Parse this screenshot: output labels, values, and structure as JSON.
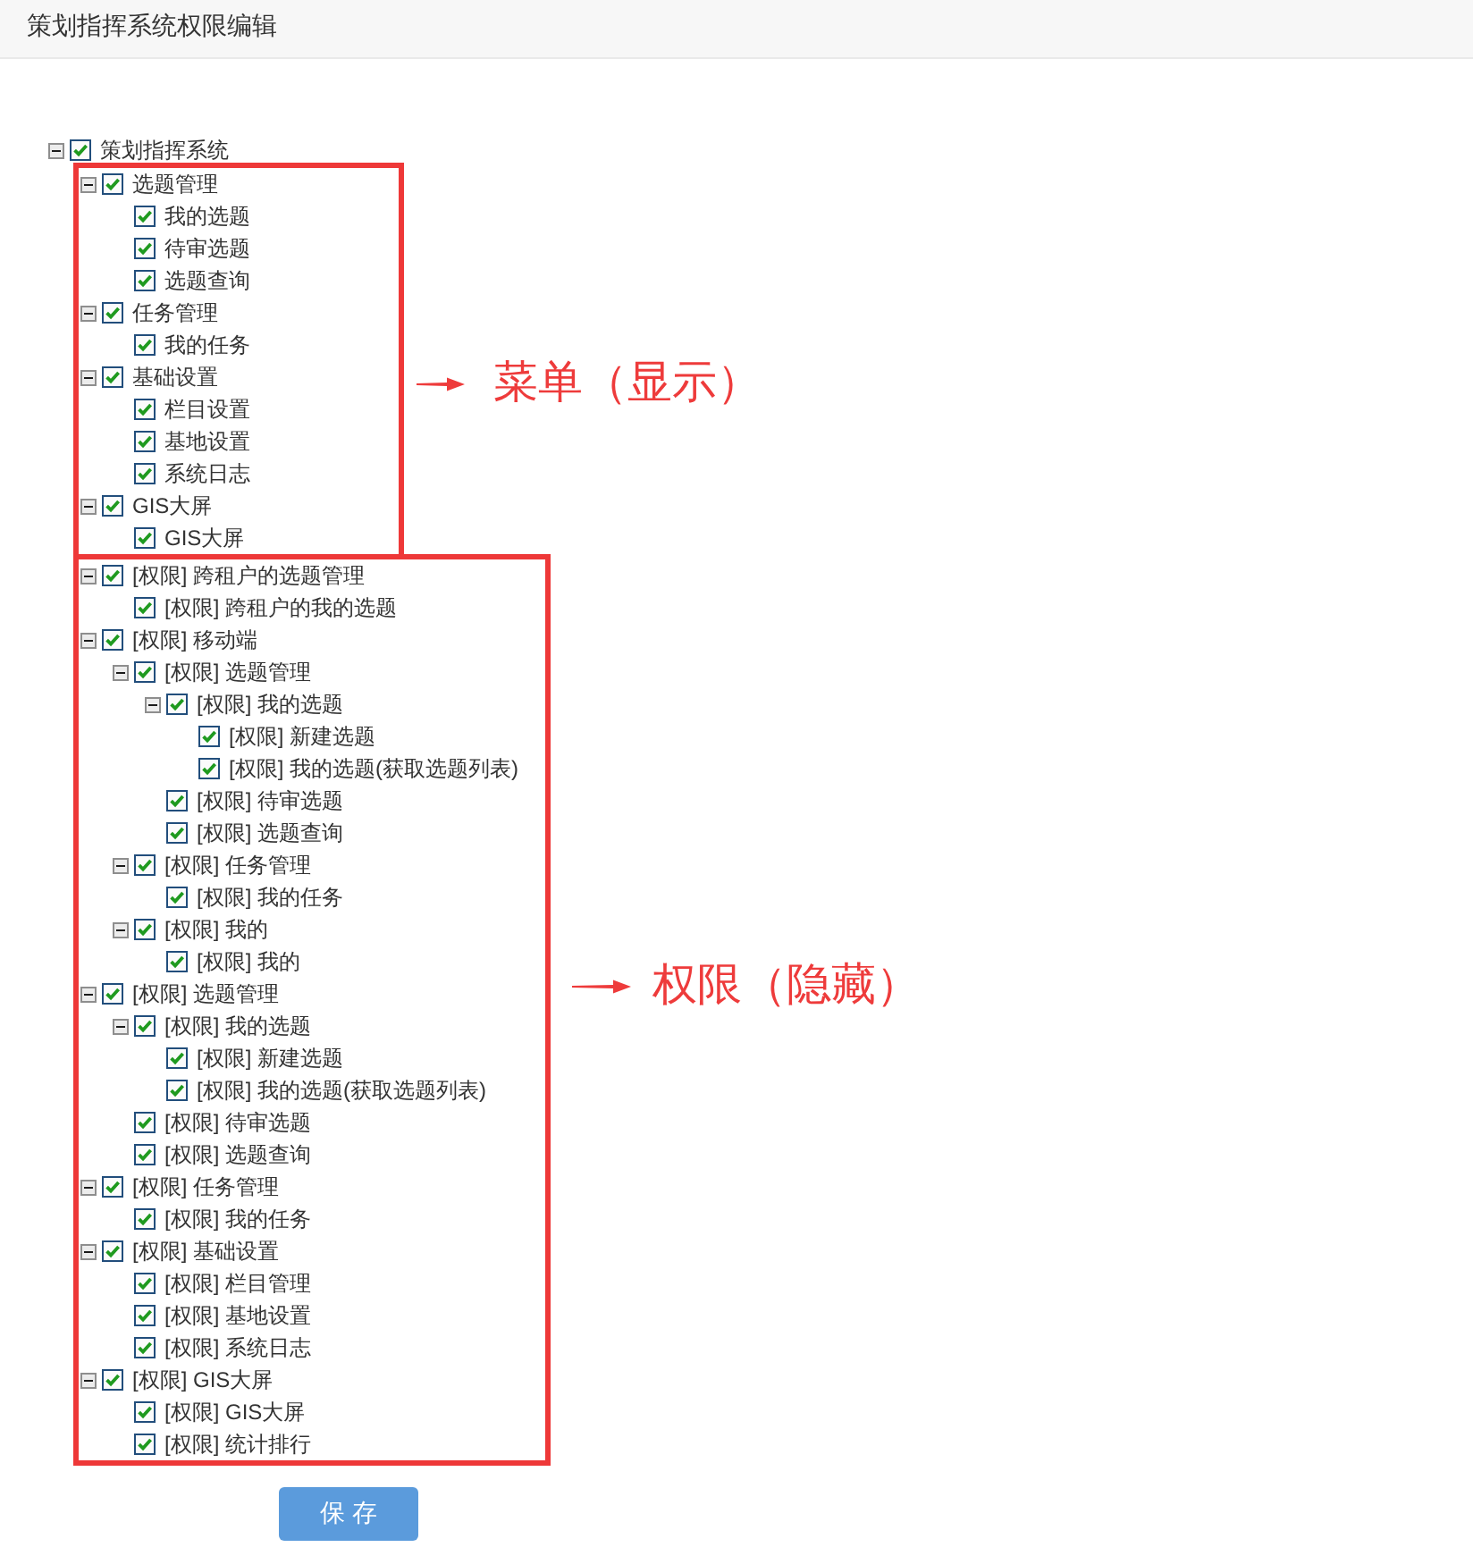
{
  "header": {
    "title": "策划指挥系统权限编辑"
  },
  "tree": {
    "label": "策划指挥系统",
    "checked": true,
    "expanded": true,
    "sections": [
      {
        "annotation": "菜单（显示）",
        "children": [
          {
            "label": "选题管理",
            "checked": true,
            "expanded": true,
            "children": [
              {
                "label": "我的选题",
                "checked": true
              },
              {
                "label": "待审选题",
                "checked": true
              },
              {
                "label": "选题查询",
                "checked": true
              }
            ]
          },
          {
            "label": "任务管理",
            "checked": true,
            "expanded": true,
            "children": [
              {
                "label": "我的任务",
                "checked": true
              }
            ]
          },
          {
            "label": "基础设置",
            "checked": true,
            "expanded": true,
            "children": [
              {
                "label": "栏目设置",
                "checked": true
              },
              {
                "label": "基地设置",
                "checked": true
              },
              {
                "label": "系统日志",
                "checked": true
              }
            ]
          },
          {
            "label": "GIS大屏",
            "checked": true,
            "expanded": true,
            "children": [
              {
                "label": "GIS大屏",
                "checked": true
              }
            ]
          }
        ]
      },
      {
        "annotation": "权限（隐藏）",
        "children": [
          {
            "label": "[权限] 跨租户的选题管理",
            "checked": true,
            "expanded": true,
            "children": [
              {
                "label": "[权限] 跨租户的我的选题",
                "checked": true
              }
            ]
          },
          {
            "label": "[权限] 移动端",
            "checked": true,
            "expanded": true,
            "children": [
              {
                "label": "[权限] 选题管理",
                "checked": true,
                "expanded": true,
                "children": [
                  {
                    "label": "[权限] 我的选题",
                    "checked": true,
                    "expanded": true,
                    "children": [
                      {
                        "label": "[权限] 新建选题",
                        "checked": true
                      },
                      {
                        "label": "[权限] 我的选题(获取选题列表)",
                        "checked": true
                      }
                    ]
                  },
                  {
                    "label": "[权限] 待审选题",
                    "checked": true
                  },
                  {
                    "label": "[权限] 选题查询",
                    "checked": true
                  }
                ]
              },
              {
                "label": "[权限] 任务管理",
                "checked": true,
                "expanded": true,
                "children": [
                  {
                    "label": "[权限] 我的任务",
                    "checked": true
                  }
                ]
              },
              {
                "label": "[权限] 我的",
                "checked": true,
                "expanded": true,
                "children": [
                  {
                    "label": "[权限] 我的",
                    "checked": true
                  }
                ]
              }
            ]
          },
          {
            "label": "[权限] 选题管理",
            "checked": true,
            "expanded": true,
            "children": [
              {
                "label": "[权限] 我的选题",
                "checked": true,
                "expanded": true,
                "children": [
                  {
                    "label": "[权限] 新建选题",
                    "checked": true
                  },
                  {
                    "label": "[权限] 我的选题(获取选题列表)",
                    "checked": true
                  }
                ]
              },
              {
                "label": "[权限] 待审选题",
                "checked": true
              },
              {
                "label": "[权限] 选题查询",
                "checked": true
              }
            ]
          },
          {
            "label": "[权限] 任务管理",
            "checked": true,
            "expanded": true,
            "children": [
              {
                "label": "[权限] 我的任务",
                "checked": true
              }
            ]
          },
          {
            "label": "[权限] 基础设置",
            "checked": true,
            "expanded": true,
            "children": [
              {
                "label": "[权限] 栏目管理",
                "checked": true
              },
              {
                "label": "[权限] 基地设置",
                "checked": true
              },
              {
                "label": "[权限] 系统日志",
                "checked": true
              }
            ]
          },
          {
            "label": "[权限] GIS大屏",
            "checked": true,
            "expanded": true,
            "children": [
              {
                "label": "[权限] GIS大屏",
                "checked": true
              },
              {
                "label": "[权限] 统计排行",
                "checked": true
              }
            ]
          }
        ]
      }
    ]
  },
  "save_button": {
    "label": "保 存"
  }
}
